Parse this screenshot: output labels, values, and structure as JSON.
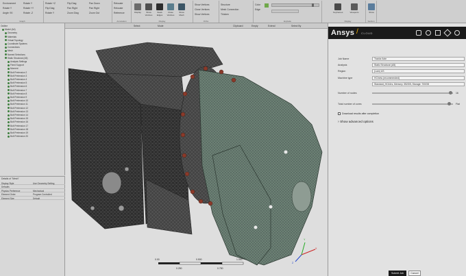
{
  "ribbon": {
    "col1": [
      "Environment",
      "Rotate Y",
      "Angle: 90"
    ],
    "col2": [
      "Rotate Y",
      "Rotate +Y",
      "Rotate -Z"
    ],
    "col3": [
      "Rotate +Z",
      "Flip Diag",
      "Rotate Y"
    ],
    "col4": [
      "Flip Diag",
      "Pan Right",
      "Zoom Diag"
    ],
    "col5": [
      "Pan Down",
      "Pan Right",
      "Zoom Out"
    ],
    "col6": [
      "Relocate",
      "Relocate",
      "Reference"
    ],
    "group_graph": "Graph",
    "group_annotation": "Annotation",
    "group_ortho": "Ortho",
    "group_display": "Display",
    "btn_display": "Display",
    "btn_show_vertices": "Show Vertices",
    "btn_close_vertices": "Close Vertices",
    "btn_stack_edges": "Stack Edges",
    "btn_show_mesh": "Show Mesh",
    "col_vertices": [
      "Show Vertices",
      "Close Vertices",
      "Show Vertices"
    ],
    "col_connect": [
      "Structure",
      "Mesh Connection",
      "Thicken"
    ],
    "col_color": [
      "Color",
      "Edge"
    ],
    "group_explode": "Explode",
    "group_display2": "Display",
    "btn_keyframes": "Keyframes",
    "btn_viewports": "Viewports",
    "btn_show": "Show",
    "group_section": "Section"
  },
  "toolbar": {
    "items": [
      "Select",
      "Mode",
      "Clipboard",
      "Empty",
      "Extend",
      "Select By"
    ]
  },
  "tree": {
    "items": [
      "Outline",
      "Model (A4)",
      "Geometry",
      "Materials",
      "Virtual Topology",
      "Coordinate Systems",
      "Connections",
      "Mesh",
      "Named Selections",
      "Static Structural (A5)",
      "Analysis Settings",
      "Fixed Support",
      "Moment",
      "Bolt Pretension 2",
      "Bolt Pretension 3",
      "Bolt Pretension 4",
      "Bolt Pretension 5",
      "Bolt Pretension 6",
      "Bolt Pretension 7",
      "Bolt Pretension 8",
      "Bolt Pretension 9",
      "Bolt Pretension 10",
      "Bolt Pretension 11",
      "Bolt Pretension 12",
      "Bolt Pretension 13",
      "Bolt Pretension 14",
      "Bolt Pretension 15",
      "Bolt Pretension 16",
      "Bolt Pretension 17",
      "Bolt Pretension 18",
      "Bolt Pretension 19",
      "Bolt Pretension 20"
    ]
  },
  "details": {
    "title": "Details of \"Mesh\"",
    "rows": [
      {
        "k": "Display Style",
        "v": "Use Geometry Setting"
      },
      {
        "k": "Defaults",
        "v": ""
      },
      {
        "k": "Physics Preference",
        "v": "Mechanical"
      },
      {
        "k": "Element Order",
        "v": "Program Controlled"
      },
      {
        "k": "Element Size",
        "v": "Default"
      }
    ]
  },
  "viewport": {
    "scale_labels": [
      "0.00",
      "0.250",
      "0.500",
      "0.750",
      "1.000"
    ],
    "scale_units": [
      "(m)",
      "(m)"
    ],
    "axis": [
      "X",
      "Y",
      "Z"
    ]
  },
  "ansys": {
    "brand": "Ansys",
    "sub": "CLOUD",
    "fields": [
      {
        "label": "Job Name",
        "value": "Tractor Axle"
      },
      {
        "label": "Analysis",
        "value": "Static Structural (A5)"
      },
      {
        "label": "Region",
        "value": "(Lam) US"
      },
      {
        "label": "Machine type",
        "value": "HCInew (recommended)"
      },
      {
        "label": "",
        "value": "Standard_HC44rs, Memory: 352GB, Storage: 700GB"
      },
      {
        "label": "Number of nodes",
        "value": "16"
      },
      {
        "label": "Total number of cores",
        "value": "Flat"
      }
    ],
    "checkbox_label": "Download results after completion",
    "advanced_label": "Show advanced options",
    "submit": "Submit Job",
    "cancel": "Cancel"
  }
}
